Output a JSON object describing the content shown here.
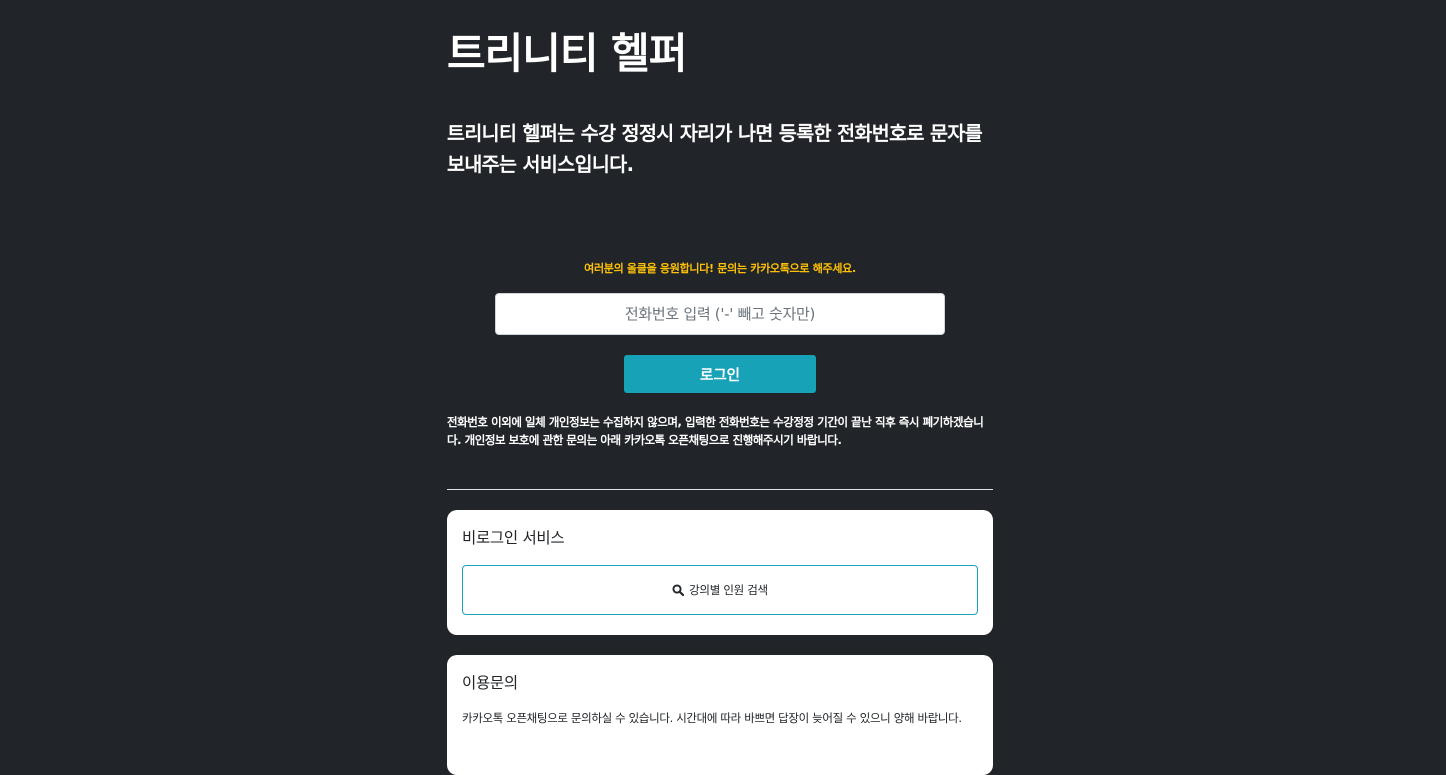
{
  "header": {
    "title": "트리니티 헬퍼",
    "description": "트리니티 헬퍼는 수강 정정시 자리가 나면 등록한 전화번호로 문자를 보내주는 서비스입니다."
  },
  "login": {
    "notice": "여러분의 올클을 응원합니다! 문의는 카카오톡으로 해주세요.",
    "phone_placeholder": "전화번호 입력 ('-' 빼고 숫자만)",
    "phone_value": "",
    "button_label": "로그인",
    "privacy_text": "전화번호 이외에 일체 개인정보는 수집하지 않으며, 입력한 전화번호는 수강정정 기간이 끝난 직후 즉시 폐기하겠습니다. 개인정보 보호에 관한 문의는 아래 카카오톡 오픈채팅으로 진행해주시기 바랍니다."
  },
  "cards": {
    "guest": {
      "title": "비로그인 서비스",
      "search_label": "강의별 인원 검색",
      "search_icon": "search-icon"
    },
    "contact": {
      "title": "이용문의",
      "text": "카카오톡 오픈채팅으로 문의하실 수 있습니다. 시간대에 따라 바쁘면 답장이 늦어질 수 있으니 양해 바랍니다."
    }
  },
  "colors": {
    "background": "#212529",
    "accent": "#17a2b8",
    "notice": "#ffc107",
    "card": "#ffffff"
  }
}
